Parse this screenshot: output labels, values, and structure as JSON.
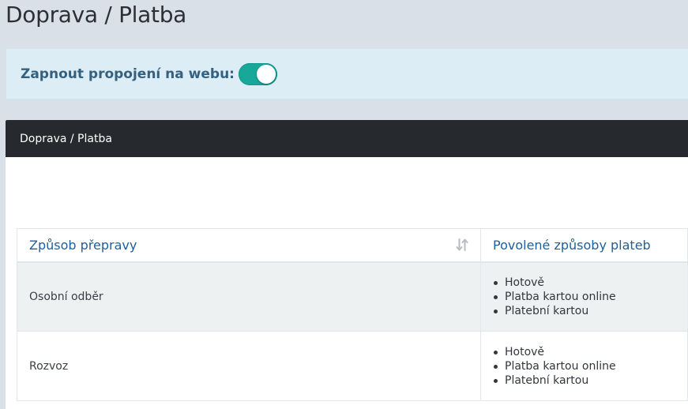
{
  "page": {
    "title": "Doprava / Platba"
  },
  "toggle": {
    "label": "Zapnout propojení na webu:",
    "state": "on",
    "accent_color": "#17a89a"
  },
  "card": {
    "header": "Doprava / Platba"
  },
  "table": {
    "columns": [
      "Způsob přepravy",
      "Povolené způsoby plateb"
    ],
    "sort_icon": "sort-arrows-icon",
    "rows": [
      {
        "method": "Osobní odběr",
        "payments": [
          "Hotově",
          "Platba kartou online",
          "Platební kartou"
        ]
      },
      {
        "method": "Rozvoz",
        "payments": [
          "Hotově",
          "Platba kartou online",
          "Platební kartou"
        ]
      }
    ]
  }
}
